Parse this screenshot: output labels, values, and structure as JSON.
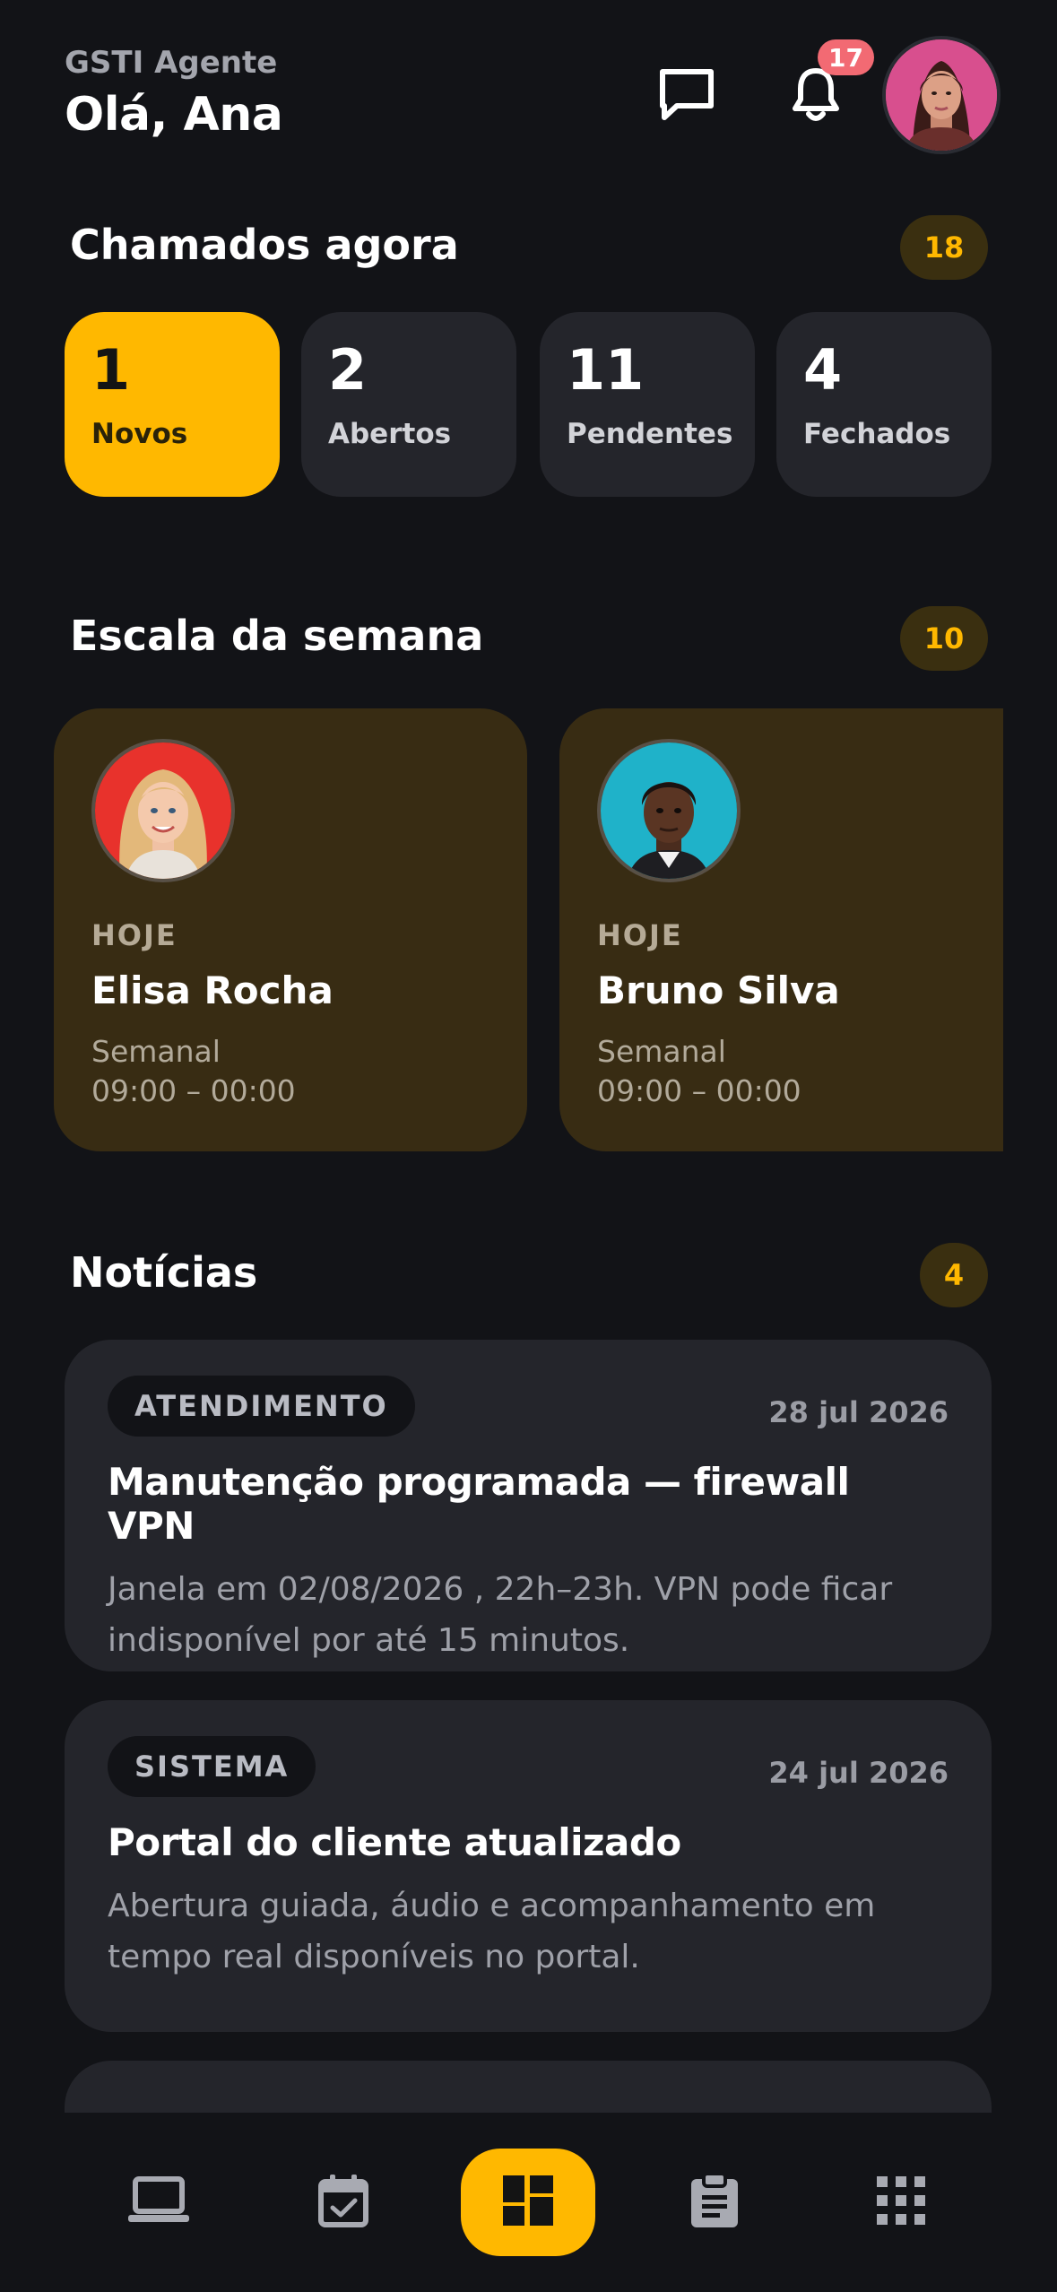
{
  "header": {
    "app_name": "GSTI Agente",
    "greeting": "Olá, Ana",
    "notification_count": "17"
  },
  "tickets": {
    "title": "Chamados agora",
    "total": "18",
    "tiles": [
      {
        "count": "1",
        "label": "Novos",
        "active": true
      },
      {
        "count": "2",
        "label": "Abertos",
        "active": false
      },
      {
        "count": "11",
        "label": "Pendentes",
        "active": false
      },
      {
        "count": "4",
        "label": "Fechados",
        "active": false
      }
    ]
  },
  "schedule": {
    "title": "Escala da semana",
    "total": "10",
    "cards": [
      {
        "day": "HOJE",
        "name": "Elisa Rocha",
        "type": "Semanal",
        "time": "09:00 – 00:00"
      },
      {
        "day": "HOJE",
        "name": "Bruno Silva",
        "type": "Semanal",
        "time": "09:00 – 00:00"
      }
    ]
  },
  "news": {
    "title": "Notícias",
    "total": "4",
    "items": [
      {
        "category": "ATENDIMENTO",
        "date": "28 jul 2026",
        "title": "Manutenção programada — firewall VPN",
        "body": "Janela em 02/08/2026 , 22h–23h. VPN pode ficar indisponível por até 15 minutos."
      },
      {
        "category": "SISTEMA",
        "date": "24 jul 2026",
        "title": "Portal do cliente atualizado",
        "body": "Abertura guiada, áudio e acompanhamento em tempo real disponíveis no portal."
      }
    ]
  },
  "nav": {
    "items": [
      {
        "icon": "laptop-icon",
        "active": false
      },
      {
        "icon": "calendar-check-icon",
        "active": false
      },
      {
        "icon": "dashboard-icon",
        "active": true
      },
      {
        "icon": "clipboard-icon",
        "active": false
      },
      {
        "icon": "apps-grid-icon",
        "active": false
      }
    ]
  },
  "colors": {
    "background": "#121317",
    "accent": "#ffb800",
    "card": "#24252b",
    "shift_card": "#382c13",
    "badge": "#f26a73"
  }
}
